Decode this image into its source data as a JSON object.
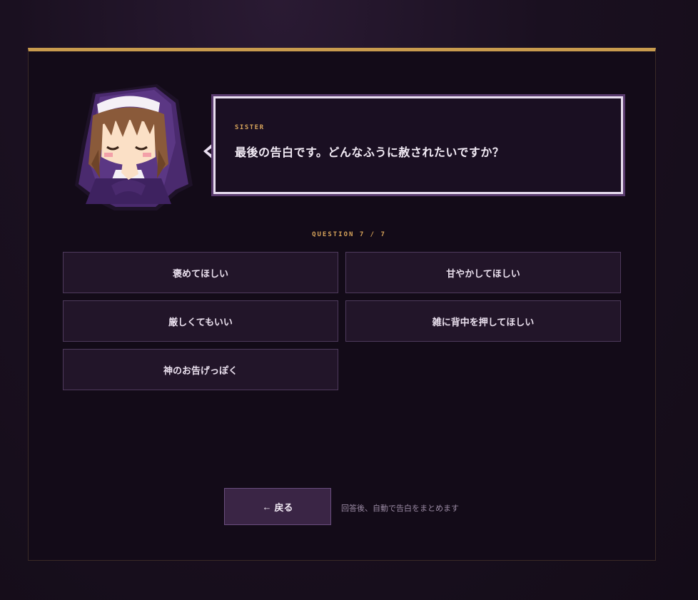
{
  "dialog": {
    "speaker": "SISTER",
    "line": "最後の告白です。どんなふうに赦されたいですか？"
  },
  "question": {
    "counter": "QUESTION 7 / 7"
  },
  "options": [
    {
      "label": "褒めてほしい"
    },
    {
      "label": "甘やかしてほしい"
    },
    {
      "label": "厳しくてもいい"
    },
    {
      "label": "雑に背中を押してほしい"
    },
    {
      "label": "神のお告げっぽく"
    }
  ],
  "footer": {
    "back_label": "戻る",
    "back_icon": "arrow-left-icon",
    "hint": "回答後、自動で告白をまとめます"
  },
  "colors": {
    "accent_gold": "#c89b4e",
    "panel_bg": "#130b18",
    "option_bg": "#221529",
    "option_border": "#4e3a5c",
    "habit_purple": "#4a2a6e"
  }
}
